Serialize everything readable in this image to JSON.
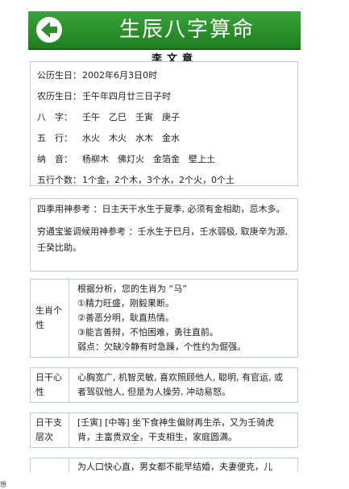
{
  "header": {
    "title": "生辰八字算命",
    "back_icon": "back-arrow-icon"
  },
  "name": "李文章",
  "basic": [
    {
      "label": "公历生日：",
      "value": "2002年6月3日0时"
    },
    {
      "label": "农历生日：",
      "value": "壬午年四月廿三日子时"
    },
    {
      "label": "八　字：",
      "value": "壬午　乙巳　壬寅　庚子"
    },
    {
      "label": "五　行：",
      "value": "水火　木火　水木　金水"
    },
    {
      "label": "纳　音：",
      "value": "杨柳木　佛灯火　金箔金　壁上土"
    },
    {
      "label": "五行个数：",
      "value": "1个金，2个木，3个水，2个火，0个土"
    }
  ],
  "ref": {
    "siji": "四季用神参考 ：日主天干水生于夏季, 必须有金相助，忌木多。",
    "qiongtong": "穷通宝鉴调候用神参考 ：壬水生于巳月，壬水弱极, 取庚辛为源, 壬癸比助。"
  },
  "table": [
    {
      "label": "生肖个性",
      "lines": [
        "根据分析，您的生肖为 “马”",
        "①精力旺盛，刚毅果断。",
        "②善恶分明，耿直热情。",
        "③能言善辩，不怕困难，勇往直前。",
        "弱点：欠缺冷静有时急躁，个性约为倔强。"
      ]
    },
    {
      "label": "日干心性",
      "lines": [
        "心胸宽广, 机智灵敏, 喜欢照顾他人, 聪明, 有官运, 或者驾驭他人, 但是为人操劳, 冲动易怒。"
      ]
    },
    {
      "label": "日干支层次",
      "lines": [
        "[壬寅] [中等] 坐下食神生偏财再生杀，又为壬骑虎背，主富贵双全，干支相生，家庭圆满。"
      ]
    },
    {
      "label": "",
      "lines": [
        "为人口快心直，男女都不能早结婚，夫妻便克，儿"
      ]
    }
  ],
  "corner": "想"
}
